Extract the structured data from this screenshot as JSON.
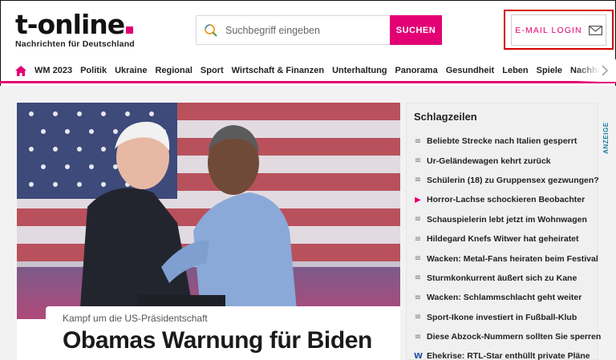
{
  "header": {
    "logo_text": "t-online",
    "logo_subtitle": "Nachrichten für Deutschland",
    "search_placeholder": "Suchbegriff eingeben",
    "search_button": "SUCHEN",
    "login_label": "E-MAIL LOGIN"
  },
  "nav": {
    "items": [
      "WM 2023",
      "Politik",
      "Ukraine",
      "Regional",
      "Sport",
      "Wirtschaft & Finanzen",
      "Unterhaltung",
      "Panorama",
      "Gesundheit",
      "Leben",
      "Spiele",
      "Nachhaltigkeit"
    ]
  },
  "hero": {
    "kicker": "Kampf um die US-Präsidentschaft",
    "title": "Obamas Warnung für Biden"
  },
  "headlines": {
    "title": "Schlagzeilen",
    "items": [
      {
        "icon": "article-icon",
        "text": "Beliebte Strecke nach Italien gesperrt"
      },
      {
        "icon": "article-icon",
        "text": "Ur-Geländewagen kehrt zurück"
      },
      {
        "icon": "article-icon",
        "text": "Schülerin (18) zu Gruppensex gezwungen?"
      },
      {
        "icon": "play-icon",
        "text": "Horror-Lachse schockieren Beobachter"
      },
      {
        "icon": "article-icon",
        "text": "Schauspielerin lebt jetzt im Wohnwagen"
      },
      {
        "icon": "article-icon",
        "text": "Hildegard Knefs Witwer hat geheiratet"
      },
      {
        "icon": "article-icon",
        "text": "Wacken: Metal-Fans heiraten beim Festival"
      },
      {
        "icon": "article-icon",
        "text": "Sturmkonkurrent äußert sich zu Kane"
      },
      {
        "icon": "article-icon",
        "text": "Wacken: Schlammschlacht geht weiter"
      },
      {
        "icon": "article-icon",
        "text": "Sport-Ikone investiert in Fußball-Klub"
      },
      {
        "icon": "article-icon",
        "text": "Diese Abzock-Nummern sollten Sie sperren"
      },
      {
        "icon": "w-icon",
        "text": "Ehekrise: RTL-Star enthüllt private Pläne"
      }
    ]
  },
  "ad_label": "ANZEIGE",
  "colors": {
    "brand": "#e20074",
    "highlight": "#d40000",
    "ad": "#1c7fa0"
  }
}
